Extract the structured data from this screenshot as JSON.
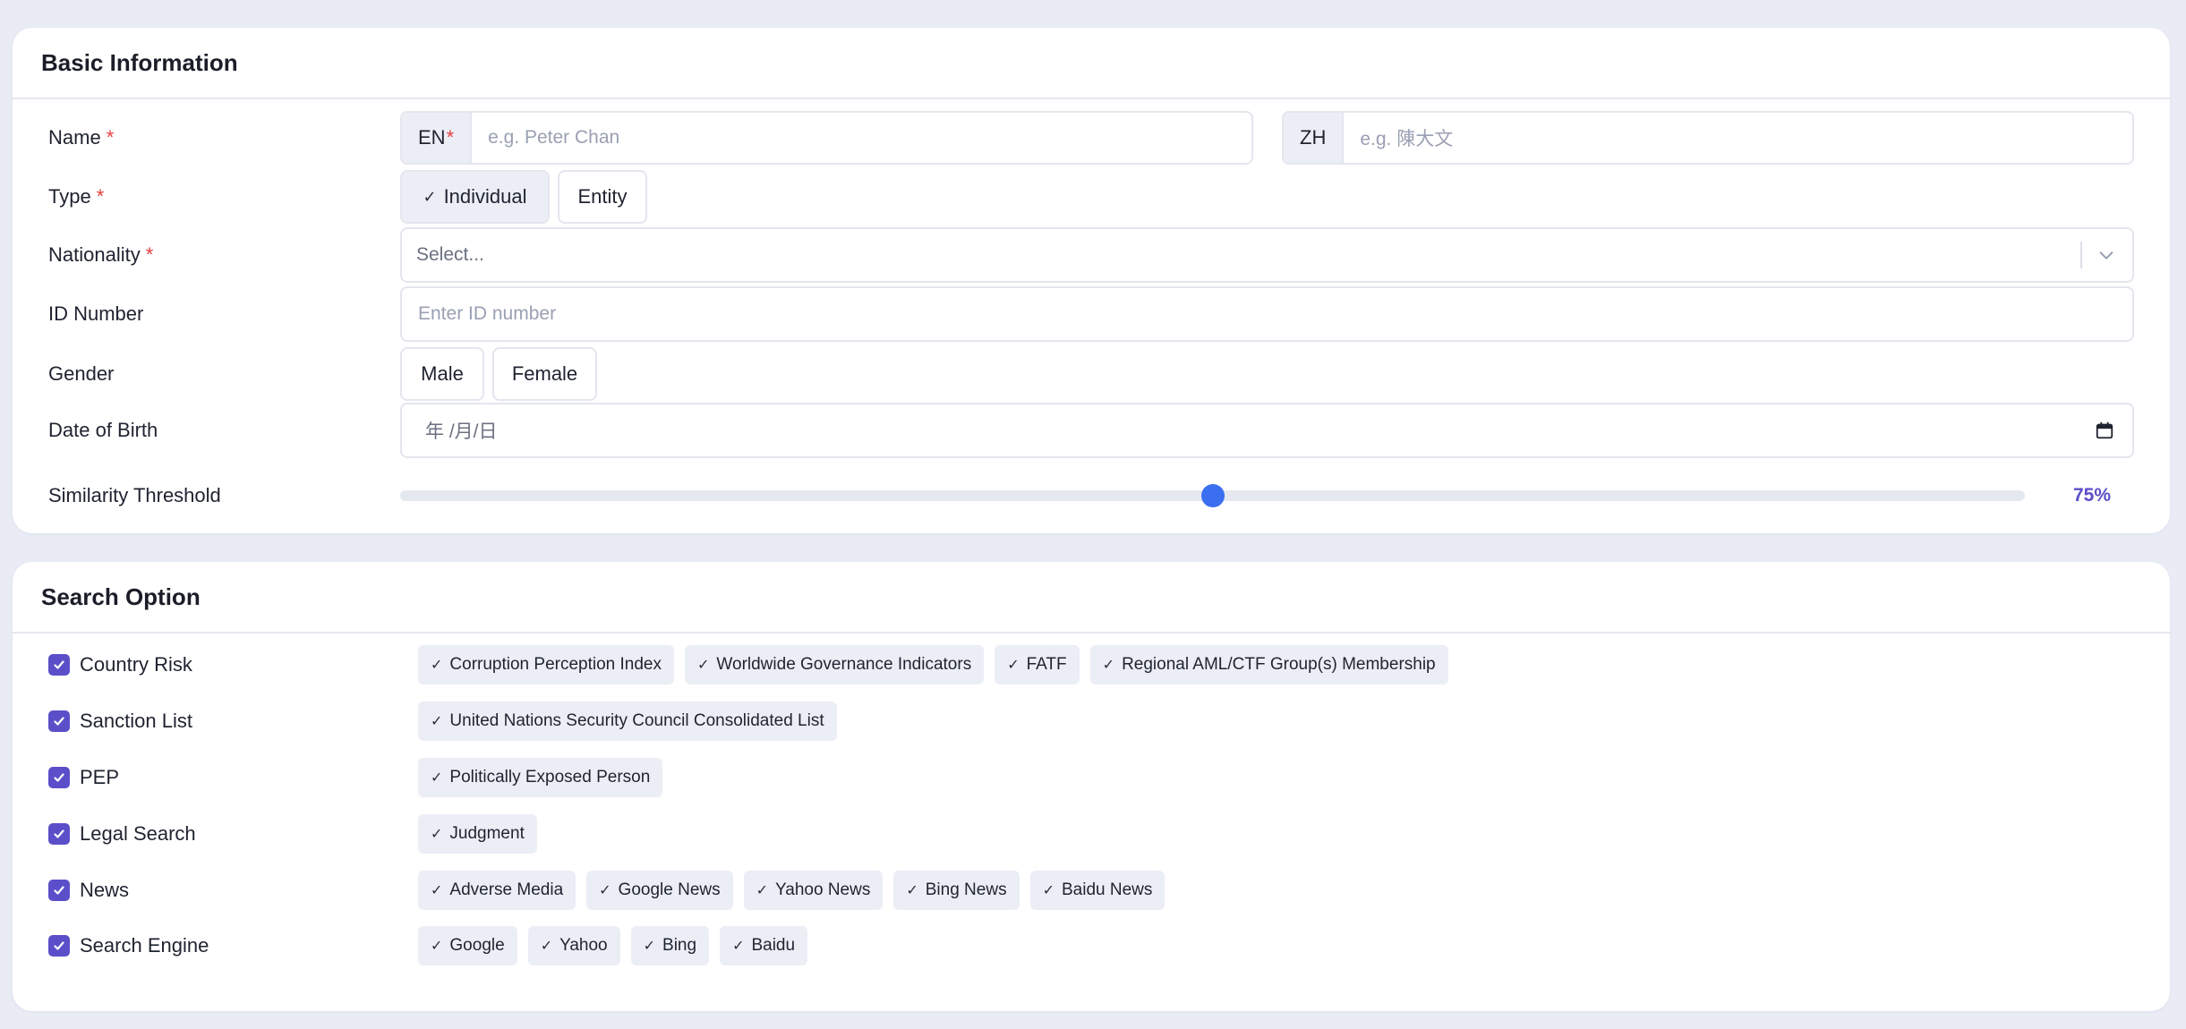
{
  "basic": {
    "title": "Basic Information",
    "name": {
      "label": "Name",
      "required": "*",
      "en_addon": "EN",
      "en_placeholder": "e.g. Peter Chan",
      "zh_addon": "ZH",
      "zh_placeholder": "e.g. 陳大文"
    },
    "type": {
      "label": "Type",
      "required": "*",
      "options": [
        {
          "label": "Individual",
          "selected": true,
          "check": "✓"
        },
        {
          "label": "Entity",
          "selected": false
        }
      ]
    },
    "nationality": {
      "label": "Nationality",
      "required": "*",
      "placeholder": "Select..."
    },
    "id_number": {
      "label": "ID Number",
      "placeholder": "Enter ID number"
    },
    "gender": {
      "label": "Gender",
      "options": [
        {
          "label": "Male"
        },
        {
          "label": "Female"
        }
      ]
    },
    "dob": {
      "label": "Date of Birth",
      "placeholder": "年 /月/日"
    },
    "similarity": {
      "label": "Similarity Threshold",
      "value": 75,
      "value_label": "75%"
    }
  },
  "search": {
    "title": "Search Option",
    "options": [
      {
        "label": "Country Risk",
        "checked": true,
        "chips": [
          "Corruption Perception Index",
          "Worldwide Governance Indicators",
          "FATF",
          "Regional AML/CTF Group(s) Membership"
        ]
      },
      {
        "label": "Sanction List",
        "checked": true,
        "chips": [
          "United Nations Security Council Consolidated List"
        ]
      },
      {
        "label": "PEP",
        "checked": true,
        "chips": [
          "Politically Exposed Person"
        ]
      },
      {
        "label": "Legal Search",
        "checked": true,
        "chips": [
          "Judgment"
        ]
      },
      {
        "label": "News",
        "checked": true,
        "chips": [
          "Adverse Media",
          "Google News",
          "Yahoo News",
          "Bing News",
          "Baidu News"
        ]
      },
      {
        "label": "Search Engine",
        "checked": true,
        "chips": [
          "Google",
          "Yahoo",
          "Bing",
          "Baidu"
        ]
      }
    ],
    "chip_check": "✓"
  },
  "colors": {
    "accent": "#5b4fc9",
    "slider": "#3b6ff0",
    "required": "#e53e3e",
    "background": "#e9ecf5"
  }
}
